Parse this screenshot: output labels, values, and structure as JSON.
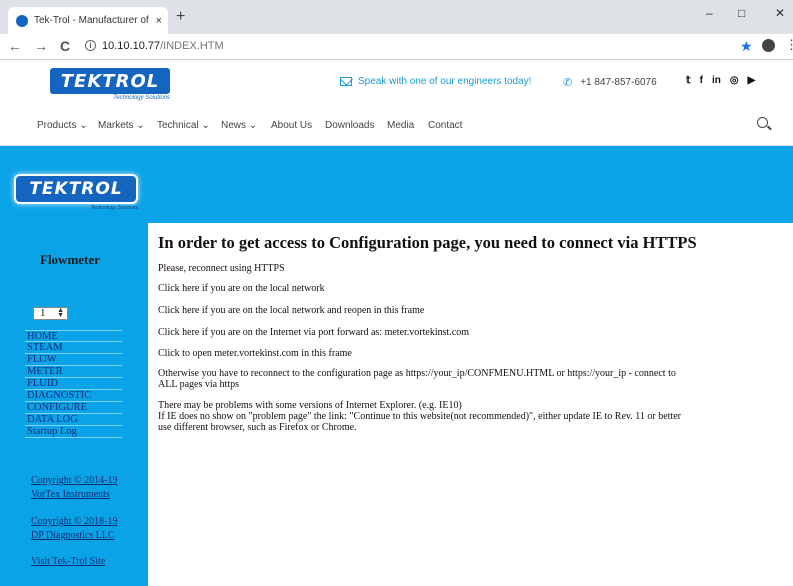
{
  "browser": {
    "tab_title": "Tek-Trol - Manufacturer of Meas",
    "tab_close": "×",
    "new_tab": "+",
    "minimize": "–",
    "maximize": "□",
    "close": "✕",
    "url_host": "10.10.10.77",
    "url_path": "/INDEX.HTM",
    "back": "←",
    "forward": "→",
    "reload": "C"
  },
  "header": {
    "logo_text": "TEKTROL",
    "logo_tagline": "Technology Solutions",
    "speak_text": "Speak with one of our engineers today!",
    "phone": "+1 847-857-6076",
    "socials": [
      "twitter-icon",
      "facebook-icon",
      "linkedin-icon",
      "instagram-icon",
      "youtube-icon"
    ]
  },
  "nav": {
    "items": [
      "Products ⌄",
      "Markets ⌄",
      "Technical ⌄",
      "News ⌄",
      "About Us",
      "Downloads",
      "Media",
      "Contact"
    ]
  },
  "left_panel": {
    "logo_text": "TEKTROL",
    "logo_tagline": "Technology Solutions",
    "title": "Flowmeter",
    "stepper_value": "1",
    "menu": [
      "HOME",
      "STEAM",
      "FLOW",
      "METER",
      "FLUID",
      "DIAGNOSTIC",
      "CONFIGURE",
      "DATA LOG",
      "Startup Log"
    ],
    "copyright1_line1": "Copyright © 2014-19",
    "copyright1_line2": "VorTex Instruments",
    "copyright2_line1": "Copyright © 2018-19",
    "copyright2_line2": "DP Diagnostics LLC",
    "visit_link": "Visit Tek-Trol Site"
  },
  "main": {
    "title": "In order to get access to Configuration page, you need to connect via HTTPS",
    "reconnect": "Please, reconnect using HTTPS",
    "link_local": "Click here if you are on the local network",
    "link_local_frame": "Click here if you are on the local network and reopen in this frame",
    "link_internet": "Click here if you are on the Internet via port forward as: meter.vortekinst.com",
    "link_open_frame": "Click to open meter.vortekinst.com in this frame",
    "otherwise_line1": "Otherwise you have to reconnect to the configuration page as https://your_ip/CONFMENU.HTML or https://your_ip - connect to",
    "otherwise_line2": "ALL pages via https",
    "ie_line1": "There may be problems with some versions of Internet Explorer. (e.g. IE10)",
    "ie_line2": "If IE does no show on \"problem page\" the link: \"Continue to this website(not recommended)\", either update IE to Rev. 11 or better",
    "ie_line3": "use different browser, such as Firefox or Chrome."
  },
  "colors": {
    "panel_blue": "#0ba3e8",
    "logo_blue": "#1565c0",
    "accent_blue": "#1a9bd7",
    "menu_text": "#0f2c73"
  }
}
